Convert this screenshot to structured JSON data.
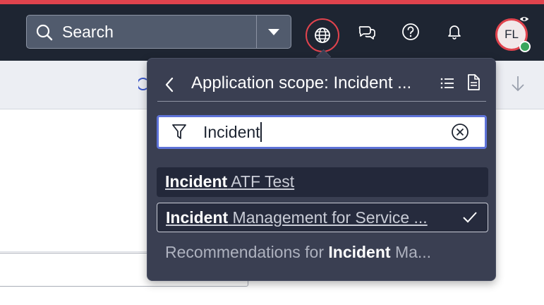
{
  "header": {
    "search_label": "Search",
    "avatar_initials": "FL"
  },
  "scope_popover": {
    "title": "Application scope: Incident ...",
    "filter_value": "Incident",
    "results": [
      {
        "match": "Incident",
        "rest": " ATF Test",
        "selected": false
      },
      {
        "match": "Incident",
        "rest": " Management for Service ...",
        "selected": true
      },
      {
        "prefix": "Recommendations for ",
        "match": "Incident",
        "rest": " Ma...",
        "selected": false
      }
    ]
  },
  "colors": {
    "header_bg": "#1e2532",
    "accent_red": "#e0434d",
    "popover_bg": "#3a3f52",
    "filter_focus": "#5e73d8"
  }
}
